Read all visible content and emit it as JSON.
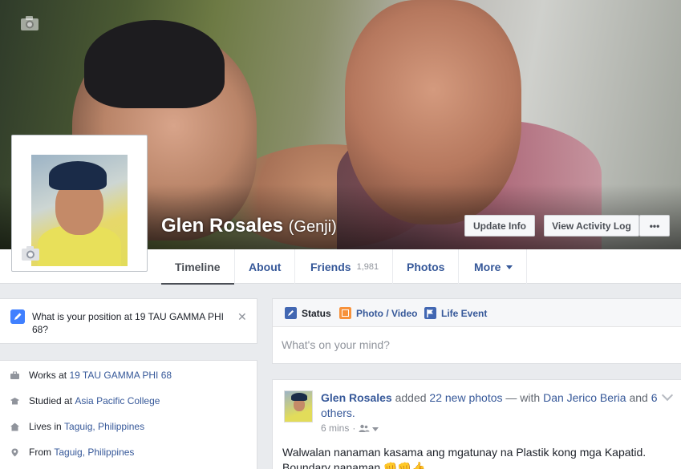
{
  "profile": {
    "name": "Glen Rosales",
    "nickname": "(Genji)"
  },
  "cover_buttons": {
    "update_info": "Update Info",
    "view_activity_log": "View Activity Log",
    "more": "•••"
  },
  "nav": {
    "tabs": [
      {
        "label": "Timeline",
        "active": true
      },
      {
        "label": "About"
      },
      {
        "label": "Friends",
        "count": "1,981"
      },
      {
        "label": "Photos"
      },
      {
        "label": "More"
      }
    ]
  },
  "question": {
    "text": "What is your position at 19 TAU GAMMA PHI 68?",
    "close": "✕"
  },
  "intro": {
    "works_prefix": "Works at",
    "works_link": "19 TAU GAMMA PHI 68",
    "studied_prefix": "Studied at",
    "studied_link": "Asia Pacific College",
    "lives_prefix": "Lives in",
    "lives_link": "Taguig, Philippines",
    "from_prefix": "From",
    "from_link": "Taguig, Philippines"
  },
  "composer": {
    "status": "Status",
    "photo_video": "Photo / Video",
    "life_event": "Life Event",
    "placeholder": "What's on your mind?"
  },
  "post": {
    "author": "Glen Rosales",
    "action_pre": "added",
    "photos_link": "22 new photos",
    "with_text": "— with",
    "tagged": "Dan Jerico Beria",
    "and_text": "and",
    "others": "6 others.",
    "time": "6 mins",
    "body": "Walwalan nanaman kasama ang mgatunay na Plastik kong mga Kapatid. Boundary nanaman 👊👊👍"
  },
  "colors": {
    "link": "#365899",
    "accent": "#4080ff",
    "background": "#e9ebee"
  }
}
